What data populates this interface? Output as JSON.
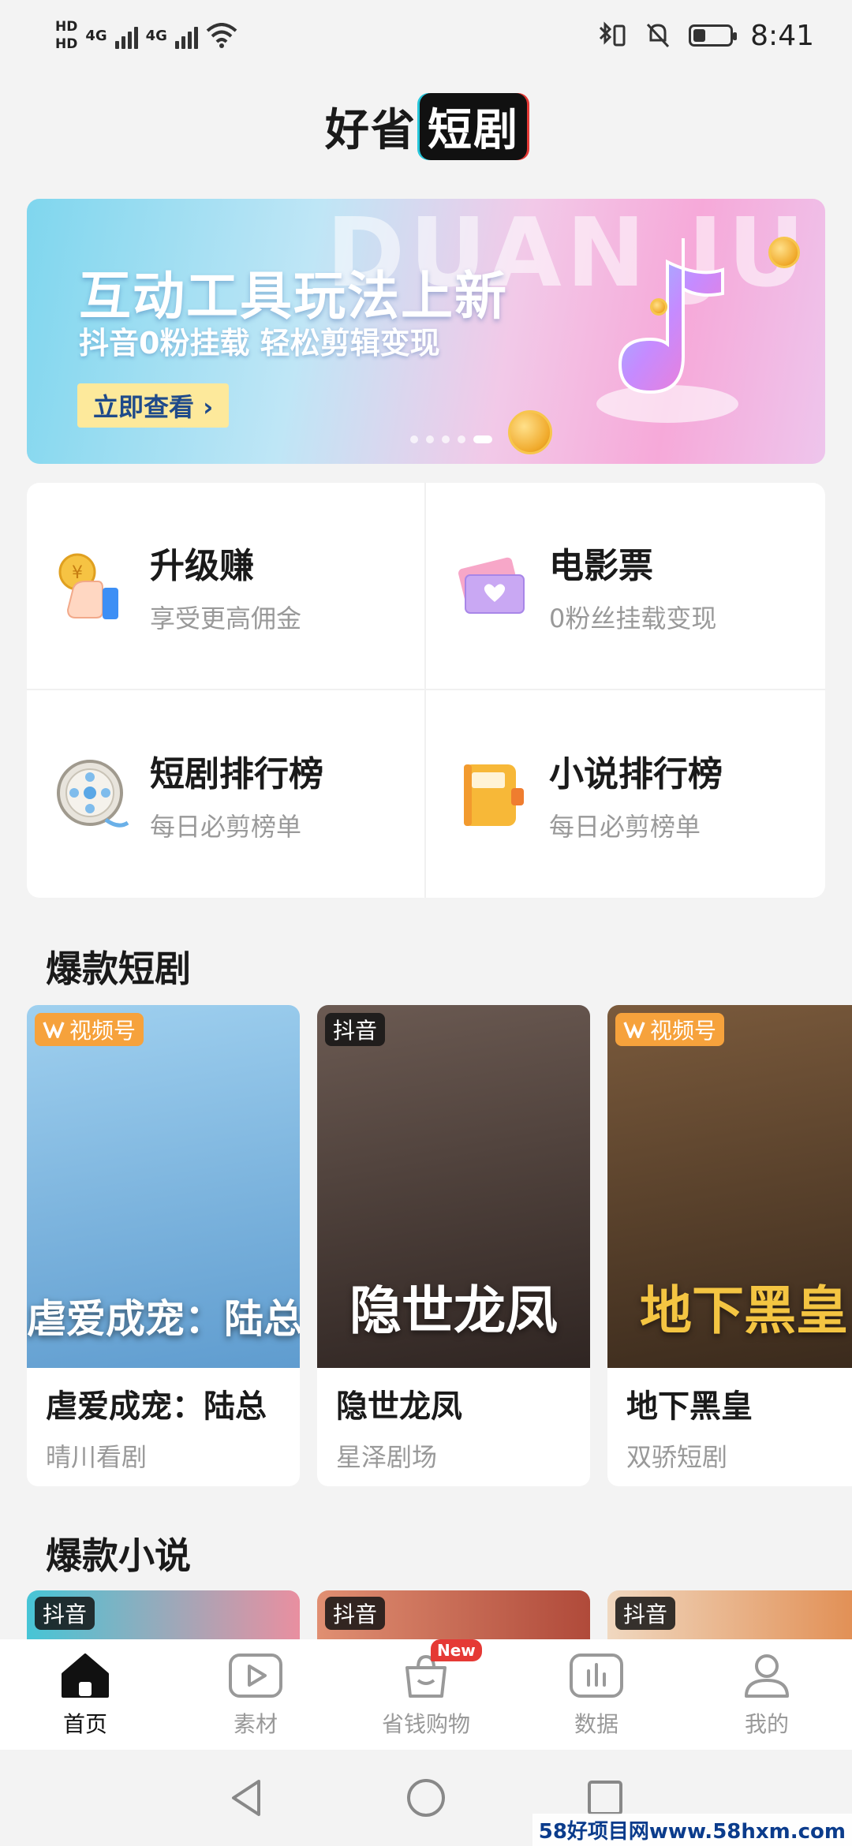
{
  "status_bar": {
    "hd1": "HD",
    "hd2": "HD",
    "net1": "4G",
    "net2": "4G",
    "time": "8:41",
    "battery_level": 0.35
  },
  "app": {
    "title_main": "好省",
    "title_highlight": "短剧"
  },
  "banner": {
    "headline": "互动工具玩法上新",
    "subline": "抖音0粉挂载 轻松剪辑变现",
    "cta": "立即查看 ›",
    "bg_word": "DUAN JU",
    "slides": 5,
    "active_slide": 5
  },
  "features": [
    {
      "title": "升级赚",
      "subtitle": "享受更高佣金",
      "icon": "thumbs-up-coin-icon"
    },
    {
      "title": "电影票",
      "subtitle": "0粉丝挂载变现",
      "icon": "movie-ticket-icon"
    },
    {
      "title": "短剧排行榜",
      "subtitle": "每日必剪榜单",
      "icon": "film-reel-icon"
    },
    {
      "title": "小说排行榜",
      "subtitle": "每日必剪榜单",
      "icon": "notebook-icon"
    }
  ],
  "hot_dramas": {
    "title": "爆款短剧",
    "items": [
      {
        "tag": "视频号",
        "tag_type": "wechat-channels",
        "poster_text": "虐爱成宠：陆总的新婚哑妻",
        "name": "虐爱成宠：陆总",
        "source": "晴川看剧",
        "colors": [
          "#9fd0ef",
          "#5f9ccf"
        ]
      },
      {
        "tag": "抖音",
        "tag_type": "douyin",
        "poster_text": "隐世龙凤",
        "name": "隐世龙凤",
        "source": "星泽剧场",
        "colors": [
          "#6b5a52",
          "#2f2522"
        ]
      },
      {
        "tag": "视频号",
        "tag_type": "wechat-channels",
        "poster_text": "地下黑皇",
        "name": "地下黑皇",
        "source": "双骄短剧",
        "colors": [
          "#7a5a3c",
          "#3a2a1c"
        ]
      }
    ]
  },
  "hot_novels": {
    "title": "爆款小说",
    "items": [
      {
        "tag": "抖音",
        "colors": [
          "#46c5d6",
          "#e98fa0"
        ]
      },
      {
        "tag": "抖音",
        "colors": [
          "#e08f72",
          "#b04a3a"
        ]
      },
      {
        "tag": "抖音",
        "colors": [
          "#f0d8c0",
          "#e0884a"
        ]
      }
    ]
  },
  "tabs": [
    {
      "label": "首页",
      "icon": "home-icon",
      "active": true
    },
    {
      "label": "素材",
      "icon": "play-icon",
      "active": false
    },
    {
      "label": "省钱购物",
      "icon": "shopping-bag-icon",
      "active": false,
      "badge": "New"
    },
    {
      "label": "数据",
      "icon": "chart-icon",
      "active": false
    },
    {
      "label": "我的",
      "icon": "user-icon",
      "active": false
    }
  ],
  "watermark": "58好项目网www.58hxm.com"
}
